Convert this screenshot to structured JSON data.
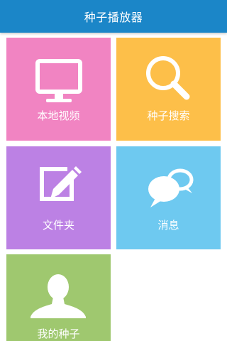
{
  "app": {
    "title": "种子播放器"
  },
  "tiles": [
    {
      "label": "本地视频",
      "color": "#f184c2",
      "icon": "monitor-icon"
    },
    {
      "label": "种子搜索",
      "color": "#fdbf49",
      "icon": "magnifier-icon"
    },
    {
      "label": "文件夹",
      "color": "#bc81e4",
      "icon": "edit-pencil-icon"
    },
    {
      "label": "消息",
      "color": "#6ec9f0",
      "icon": "chat-bubbles-icon"
    },
    {
      "label": "我的种子",
      "color": "#9fc86f",
      "icon": "person-icon"
    }
  ]
}
